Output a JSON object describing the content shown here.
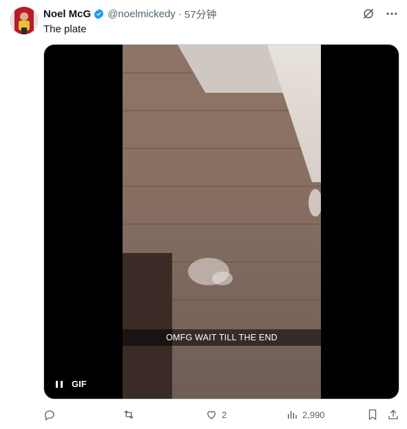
{
  "author": {
    "name": "Noel McG",
    "handle": "@noelmickedy",
    "separator": "·",
    "time": "57分钟",
    "verified_color": "#1d9bf0"
  },
  "tweet": {
    "text": "The plate"
  },
  "media": {
    "caption": "OMFG WAIT TILL THE END",
    "gif_label": "GIF"
  },
  "actions": {
    "replies": "",
    "reposts": "",
    "likes": "2",
    "views": "2,990"
  },
  "icons": {
    "grok": "grok-icon",
    "more": "more-icon",
    "reply": "reply-icon",
    "repost": "repost-icon",
    "like": "heart-icon",
    "views": "views-icon",
    "bookmark": "bookmark-icon",
    "share": "share-icon",
    "pause": "pause-icon"
  }
}
